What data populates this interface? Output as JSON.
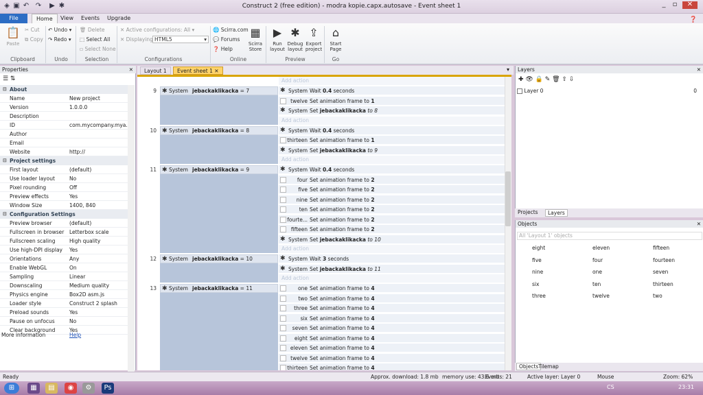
{
  "window": {
    "title": "Construct 2  (free edition) - modra kopie.capx.autosave - Event sheet 1"
  },
  "ribbon_tabs": [
    "File",
    "Home",
    "View",
    "Events",
    "Upgrade"
  ],
  "ribbon": {
    "clipboard": {
      "label": "Clipboard",
      "paste": "Paste",
      "cut": "Cut",
      "copy": "Copy"
    },
    "undo": {
      "label": "Undo",
      "undo": "Undo",
      "redo": "Redo"
    },
    "selection": {
      "label": "Selection",
      "delete": "Delete",
      "select_all": "Select All",
      "select_none": "Select None"
    },
    "configurations": {
      "label": "Configurations",
      "active": "Active configurations: All",
      "displaying": "Displaying:",
      "displaying_value": "HTML5"
    },
    "online": {
      "label": "Online",
      "scirra": "Scirra.com",
      "forums": "Forums",
      "help": "Help",
      "store": "Scirra Store"
    },
    "preview": {
      "label": "Preview",
      "run": "Run layout",
      "debug": "Debug layout",
      "export": "Export project"
    },
    "go": {
      "label": "Go",
      "start": "Start Page"
    }
  },
  "properties": {
    "title": "Properties",
    "sections": [
      {
        "name": "About",
        "rows": [
          [
            "Name",
            "New project"
          ],
          [
            "Version",
            "1.0.0.0"
          ],
          [
            "Description",
            ""
          ],
          [
            "ID",
            "com.mycompany.mya..."
          ],
          [
            "Author",
            ""
          ],
          [
            "Email",
            ""
          ],
          [
            "Website",
            "http://"
          ]
        ]
      },
      {
        "name": "Project settings",
        "rows": [
          [
            "First layout",
            "(default)"
          ],
          [
            "Use loader layout",
            "No"
          ],
          [
            "Pixel rounding",
            "Off"
          ],
          [
            "Preview effects",
            "Yes"
          ],
          [
            "Window Size",
            "1400, 840"
          ]
        ]
      },
      {
        "name": "Configuration Settings",
        "rows": [
          [
            "Preview browser",
            "(default)"
          ],
          [
            "Fullscreen in browser",
            "Letterbox scale"
          ],
          [
            "Fullscreen scaling",
            "High quality"
          ],
          [
            "Use high-DPI display",
            "Yes"
          ],
          [
            "Orientations",
            "Any"
          ],
          [
            "Enable WebGL",
            "On"
          ],
          [
            "Sampling",
            "Linear"
          ],
          [
            "Downscaling",
            "Medium quality"
          ],
          [
            "Physics engine",
            "Box2D asm.js"
          ],
          [
            "Loader style",
            "Construct 2 splash"
          ],
          [
            "Preload sounds",
            "Yes"
          ],
          [
            "Pause on unfocus",
            "No"
          ],
          [
            "Clear background",
            "Yes"
          ]
        ]
      }
    ],
    "more_info": "More information",
    "help_link": "Help"
  },
  "editor_tabs": [
    "Layout 1",
    "Event sheet 1"
  ],
  "events": [
    {
      "num": "9",
      "obj": "System",
      "var": "jebackaklikacka",
      "cond": "= 7",
      "actions": [
        [
          "System",
          "Wait ",
          "0.4",
          " seconds"
        ],
        [
          "twelve",
          "Set animation frame to ",
          "1",
          ""
        ],
        [
          "System",
          "Set ",
          "jebackaklikacka",
          " to 8"
        ]
      ]
    },
    {
      "num": "10",
      "obj": "System",
      "var": "jebackaklikacka",
      "cond": "= 8",
      "actions": [
        [
          "System",
          "Wait ",
          "0.4",
          " seconds"
        ],
        [
          "thirteen",
          "Set animation frame to ",
          "1",
          ""
        ],
        [
          "System",
          "Set ",
          "jebackaklikacka",
          " to 9"
        ]
      ]
    },
    {
      "num": "11",
      "obj": "System",
      "var": "jebackaklikacka",
      "cond": "= 9",
      "actions": [
        [
          "System",
          "Wait ",
          "0.4",
          " seconds"
        ],
        [
          "four",
          "Set animation frame to ",
          "2",
          ""
        ],
        [
          "five",
          "Set animation frame to ",
          "2",
          ""
        ],
        [
          "nine",
          "Set animation frame to ",
          "2",
          ""
        ],
        [
          "ten",
          "Set animation frame to ",
          "2",
          ""
        ],
        [
          "fourte...",
          "Set animation frame to ",
          "2",
          ""
        ],
        [
          "fifteen",
          "Set animation frame to ",
          "2",
          ""
        ],
        [
          "System",
          "Set ",
          "jebackaklikacka",
          " to 10"
        ]
      ]
    },
    {
      "num": "12",
      "obj": "System",
      "var": "jebackaklikacka",
      "cond": "= 10",
      "actions": [
        [
          "System",
          "Wait ",
          "3",
          " seconds"
        ],
        [
          "System",
          "Set ",
          "jebackaklikacka",
          " to 11"
        ]
      ]
    },
    {
      "num": "13",
      "obj": "System",
      "var": "jebackaklikacka",
      "cond": "= 11",
      "actions": [
        [
          "one",
          "Set animation frame to ",
          "4",
          ""
        ],
        [
          "two",
          "Set animation frame to ",
          "4",
          ""
        ],
        [
          "three",
          "Set animation frame to ",
          "4",
          ""
        ],
        [
          "six",
          "Set animation frame to ",
          "4",
          ""
        ],
        [
          "seven",
          "Set animation frame to ",
          "4",
          ""
        ],
        [
          "eight",
          "Set animation frame to ",
          "4",
          ""
        ],
        [
          "eleven",
          "Set animation frame to ",
          "4",
          ""
        ],
        [
          "twelve",
          "Set animation frame to ",
          "4",
          ""
        ],
        [
          "thirteen",
          "Set animation frame to ",
          "4",
          ""
        ]
      ]
    }
  ],
  "add_action": "Add action",
  "layers": {
    "title": "Layers",
    "items": [
      {
        "name": "Layer 0",
        "count": "0"
      }
    ],
    "tabs": [
      "Projects",
      "Layers"
    ]
  },
  "objects": {
    "title": "Objects",
    "filter": "All 'Layout 1' objects",
    "items": [
      "eight",
      "eleven",
      "fifteen",
      "five",
      "four",
      "fourteen",
      "nine",
      "one",
      "seven",
      "six",
      "ten",
      "thirteen",
      "three",
      "twelve",
      "two"
    ],
    "tabs": [
      "Objects",
      "Tilemap"
    ]
  },
  "status": {
    "ready": "Ready",
    "download": "Approx. download: 1.8 mb",
    "memory": "memory use: 43.6 mb",
    "events": "Events: 21",
    "layer": "Active layer: Layer 0",
    "mouse": "Mouse",
    "zoom": "Zoom: 62%"
  },
  "taskbar": {
    "lang": "CS",
    "time": "23:31"
  }
}
